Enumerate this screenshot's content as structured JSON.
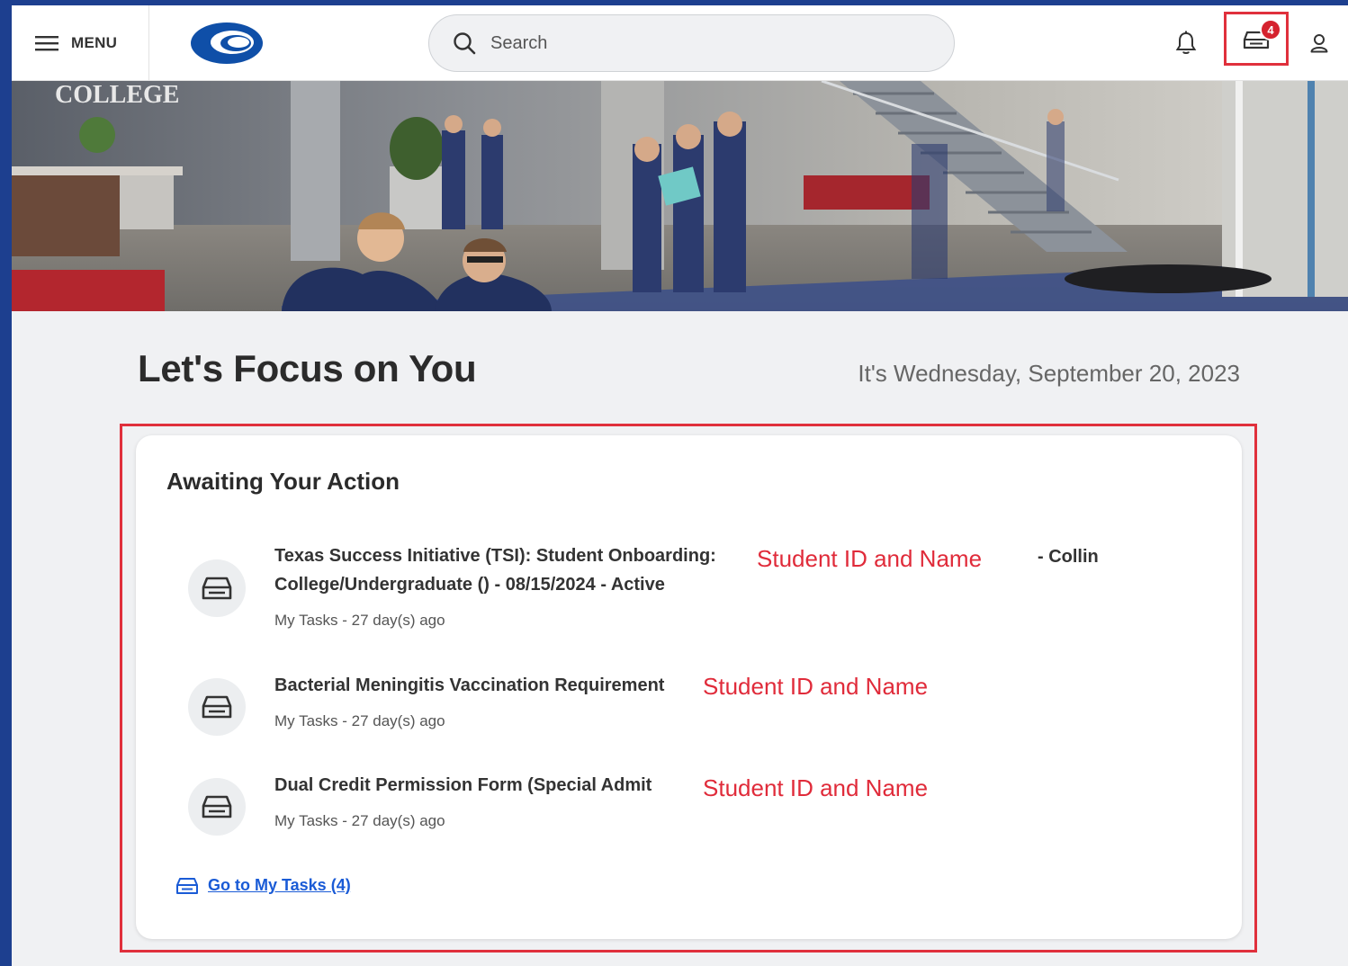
{
  "header": {
    "menu_label": "MENU",
    "search_placeholder": "Search",
    "inbox_badge": "4"
  },
  "banner": {
    "sign_text": "COLLEGE"
  },
  "main": {
    "title": "Let's Focus on You",
    "date_text": "It's Wednesday, September 20, 2023"
  },
  "awaiting": {
    "title": "Awaiting Your Action",
    "tasks": [
      {
        "title_line1": "Texas Success Initiative (TSI): Student Onboarding:",
        "title_line2": "College/Undergraduate () - 08/15/2024 - Active",
        "redacted": "Student ID and Name",
        "suffix": "- Collin",
        "meta": "My Tasks - 27 day(s) ago"
      },
      {
        "title_line1": "Bacterial Meningitis Vaccination Requirement",
        "redacted": "Student ID and Name",
        "meta": "My Tasks - 27 day(s) ago"
      },
      {
        "title_line1": "Dual Credit Permission Form (Special Admit",
        "redacted": "Student ID and Name",
        "meta": "My Tasks - 27 day(s) ago"
      }
    ],
    "go_to_label": "Go to My Tasks (4)"
  },
  "colors": {
    "accent_red": "#e0303c",
    "link_blue": "#1a5bd6",
    "frame_blue": "#1d3f8f",
    "logo_blue": "#0f4fa8"
  },
  "icons": [
    "hamburger-icon",
    "logo",
    "search-icon",
    "bell-icon",
    "inbox-icon",
    "user-icon",
    "inbox-tray-icon"
  ]
}
